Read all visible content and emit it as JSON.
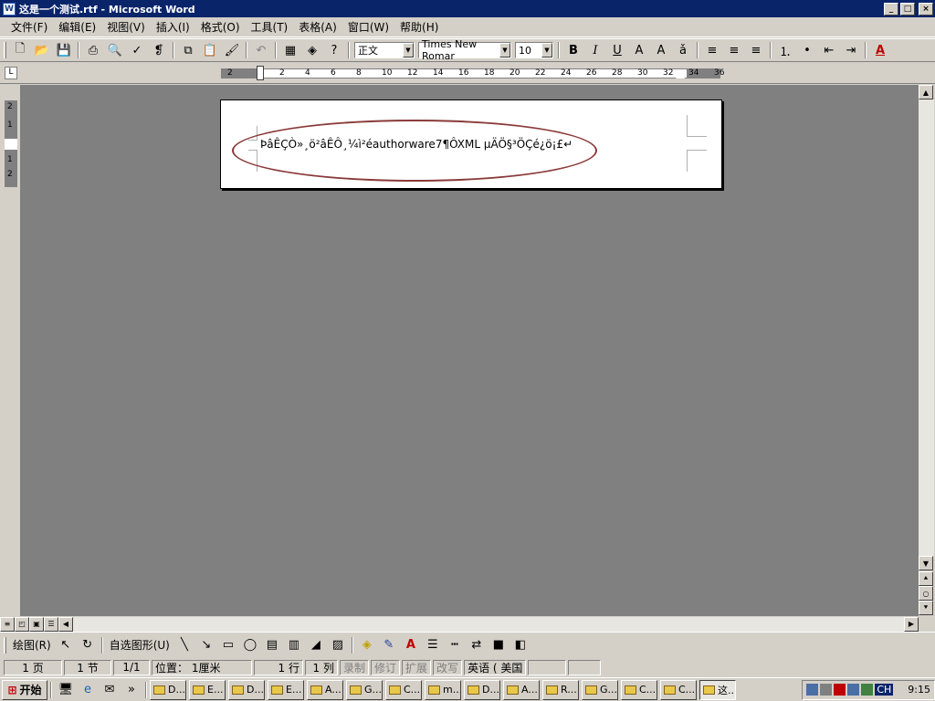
{
  "window": {
    "title": "这是一个测试.rtf - Microsoft Word",
    "controls": {
      "minimize": "_",
      "maximize": "□",
      "close": "×"
    }
  },
  "menu": [
    "文件(F)",
    "编辑(E)",
    "视图(V)",
    "插入(I)",
    "格式(O)",
    "工具(T)",
    "表格(A)",
    "窗口(W)",
    "帮助(H)"
  ],
  "formatting": {
    "style": "正文",
    "font": "Times New Romar",
    "size": "10"
  },
  "ruler": {
    "ticks": [
      "2",
      "2",
      "4",
      "6",
      "8",
      "10",
      "12",
      "14",
      "16",
      "18",
      "20",
      "22",
      "24",
      "26",
      "28",
      "30",
      "32",
      "34",
      "36"
    ],
    "vticks": [
      "2",
      "1",
      "1",
      "2"
    ]
  },
  "document": {
    "text": "ÞâÊÇÒ»¸ö²âÊÔ¸¼ì²éauthorware7¶ÔXML µÄÖ§³ÖÇé¿ö¡£↵"
  },
  "drawing_toolbar": {
    "draw_label": "绘图(R)",
    "autoshapes_label": "自选图形(U)"
  },
  "status": {
    "page": "1 页",
    "section": "1 节",
    "pages": "1/1",
    "position": "位置： 1厘米",
    "line": "1 行",
    "column": "1 列",
    "rec": "录制",
    "trk": "修订",
    "ext": "扩展",
    "ovr": "改写",
    "lang": "英语 ( 美国"
  },
  "taskbar": {
    "start": "开始",
    "buttons": [
      "D...",
      "E...",
      "D...",
      "E...",
      "A...",
      "G...",
      "C...",
      "m...",
      "D...",
      "A...",
      "R...",
      "G...",
      "C...",
      "C...",
      "这..."
    ],
    "tray_lang": "CH",
    "clock": "9:15"
  },
  "colors": {
    "titlebar": "#0a246a",
    "workspace": "#808080",
    "ellipse": "#8b3a3a",
    "chrome": "#d4d0c8"
  },
  "icons": [
    "new-icon",
    "open-icon",
    "save-icon",
    "print-icon",
    "preview-icon",
    "spell-icon",
    "cut-icon",
    "copy-icon",
    "paste-icon",
    "format-painter-icon",
    "undo-icon",
    "table-icon",
    "web-icon",
    "help-icon",
    "bold-icon",
    "italic-icon",
    "underline-icon",
    "align-left-icon",
    "center-icon",
    "align-right-icon",
    "numbering-icon",
    "bullets-icon",
    "outdent-icon",
    "indent-icon",
    "font-color-icon"
  ]
}
